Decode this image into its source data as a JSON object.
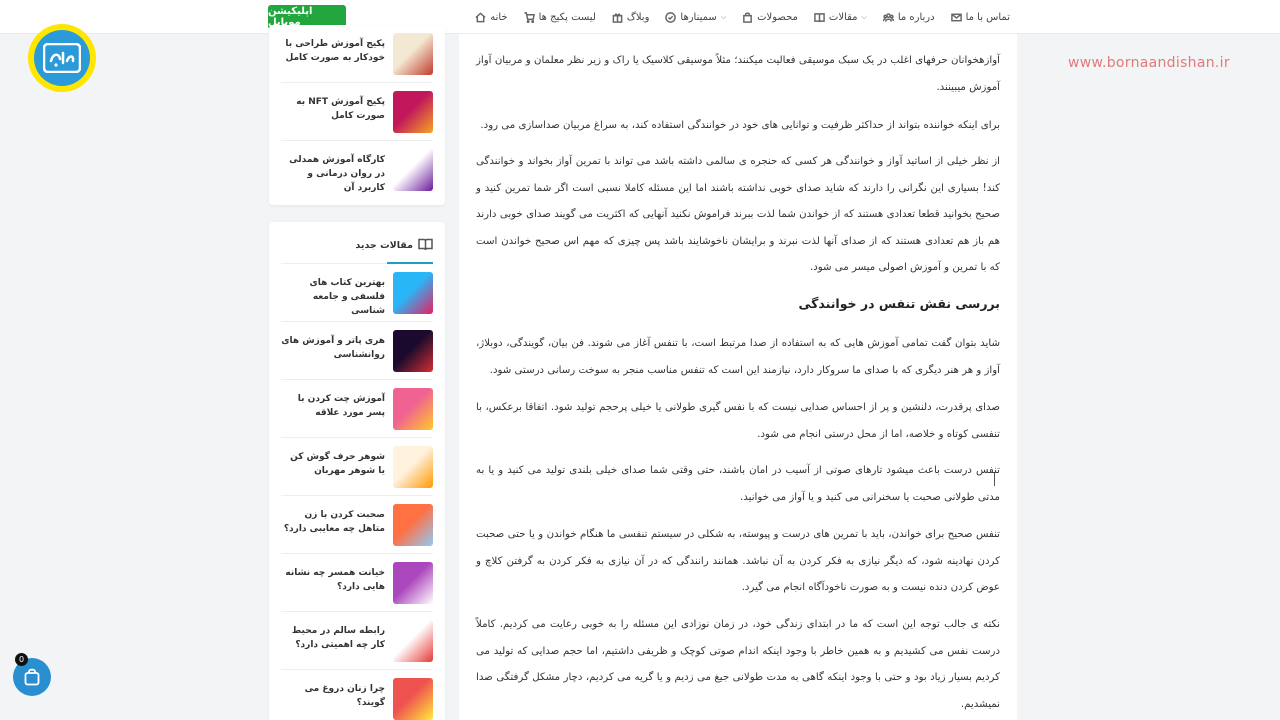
{
  "nav": {
    "items": [
      {
        "label": "خانه",
        "icon": "home-icon",
        "chevron": false
      },
      {
        "label": "لیست پکیج ها",
        "icon": "cart-icon",
        "chevron": false
      },
      {
        "label": "وبلاگ",
        "icon": "gift-icon",
        "chevron": false
      },
      {
        "label": "سمینارها",
        "icon": "check-circle-icon",
        "chevron": true
      },
      {
        "label": "محصولات",
        "icon": "bag-icon",
        "chevron": false
      },
      {
        "label": "مقالات",
        "icon": "book-icon",
        "chevron": true
      },
      {
        "label": "درباره ما",
        "icon": "users-icon",
        "chevron": false
      },
      {
        "label": "تماس با ما",
        "icon": "mail-icon",
        "chevron": false
      }
    ],
    "app_button": "اپلیکیشن موبایل"
  },
  "watermark": "www.bornaandishan.ir",
  "sidebar": {
    "packages": [
      {
        "title": "پکیج آموزش طراحی با خودکار به صورت کامل",
        "thumb_colors": [
          "#f3e9d2",
          "#c0392b"
        ]
      },
      {
        "title": "پکیج آموزش NFT به صورت کامل",
        "thumb_colors": [
          "#c2185b",
          "#f5a623"
        ]
      },
      {
        "title": "کارگاه آموزش همدلی در روان درمانی و کاربرد آن",
        "thumb_colors": [
          "#ffffff",
          "#6a1b9a"
        ]
      }
    ],
    "new_articles_title": "مقالات جدید",
    "articles": [
      {
        "title": "بهترین کتاب های فلسفی و جامعه شناسی",
        "thumb_colors": [
          "#29b6f6",
          "#e91e63"
        ]
      },
      {
        "title": "هری پاتر و آموزش های روانشناسی",
        "thumb_colors": [
          "#1a0a2e",
          "#d32f2f"
        ]
      },
      {
        "title": "آموزش چت کردن با پسر مورد علاقه",
        "thumb_colors": [
          "#f06292",
          "#ffca28"
        ]
      },
      {
        "title": "شوهر حرف گوش کن یا شوهر مهربان",
        "thumb_colors": [
          "#fff3e0",
          "#ff9800"
        ]
      },
      {
        "title": "صحبت کردن با زن متاهل چه معایبی دارد؟",
        "thumb_colors": [
          "#ff7043",
          "#90caf9"
        ]
      },
      {
        "title": "خیانت همسر چه نشانه هایی دارد؟",
        "thumb_colors": [
          "#ab47bc",
          "#ffffff"
        ]
      },
      {
        "title": "رابطه سالم در محیط کار چه اهمیتی دارد؟",
        "thumb_colors": [
          "#ffffff",
          "#e53935"
        ]
      },
      {
        "title": "چرا زنان دروغ می گویند؟",
        "thumb_colors": [
          "#ef5350",
          "#ffeb3b"
        ]
      }
    ]
  },
  "article": {
    "p1": "آوازهخوانان حرفهای اغلب در یک سبک موسیقی فعالیت میکنند؛ مثلاً موسیقی کلاسیک یا راک و زیر نظر معلمان و مربیان آواز آموزش میبینند.",
    "p2": "برای اینکه خواننده بتواند از حداکثر ظرفیت و توانایی های خود در خوانندگی استفاده کند، به سراغ مربیان صداسازی می رود.",
    "p3": "از نظر خیلی از اساتید آواز و خوانندگی هر کسی که حنجره ی سالمی داشته باشد می تواند با تمرین آواز بخواند و خوانندگی کند! بسیاری این نگرانی را دارند که شاید صدای خوبی نداشته باشند اما این مسئله کاملا نسبی است اگر شما تمرین کنید و صحیح بخوانید قطعا تعدادی هستند که از خواندن شما لذت ببرند فراموش نکنید آنهایی که اکثریت می گویند صدای خوبی دارند هم باز هم تعدادی هستند که از صدای آنها لذت نبرند و برایشان ناخوشایند باشد پس چیزی که مهم اس صحیح خواندن است که با تمرین و آموزش اصولی میسر می شود.",
    "heading": "بررسی نقش تنفس در خوانندگی",
    "p4": "شاید بتوان گفت تمامی آموزش هایی که به استفاده از صدا مرتبط است، با تنفس آغاز می شوند. فن بیان، گویندگی، دوبلاژ، آواز و هر هنر دیگری که با صدای ما سروکار دارد، نیازمند این است که تنفس مناسب منجر به سوخت رسانی درستی شود.",
    "p5": "صدای پرقدرت، دلنشین و پر از احساس صدایی نیست که با نفس گیری طولانی یا خیلی پرحجم تولید شود. اتفاقا برعکس، با تنفسی کوتاه و خلاصه، اما از محل درستی انجام می شود.",
    "p6": "تنفس درست باعث میشود تارهای صوتی از آسیب در امان باشند، حتی وقتی شما صدای خیلی بلندی تولید می کنید و یا به مدتی طولانی صحبت یا سخنرانی می کنید و یا آواز می خوانید.",
    "p7": "تنفس صحیح برای خواندن، باید با تمرین های درست و پیوسته، به شکلی در سیستم تنفسی ما هنگام خواندن و یا حتی صحبت کردن نهادینه شود، که دیگر نیازی به فکر کردن به آن نباشد. همانند رانندگی که در آن نیازی به فکر کردن به گرفتن کلاچ و عوض کردن دنده نیست و به صورت ناخودآگاه انجام می گیرد.",
    "p8": "نکته ی جالب توجه این است که ما در ابتدای زندگی خود، در زمان نوزادی این مسئله را به خوبی رعایت می کردیم. کاملاً درست نفس می کشیدیم و به همین خاطر با وجود اینکه اندام صوتی کوچک و ظریفی داشتیم، اما حجم صدایی که تولید می کردیم بسیار زیاد بود و حتی با وجود اینکه گاهی به مدت طولانی جیغ می زدیم و یا گریه می کردیم، دچار مشکل گرفتگی صدا نمیشدیم."
  },
  "cart": {
    "count": "0"
  },
  "colors": {
    "accent": "#22a73f",
    "link": "#1ba0c8",
    "cart": "#2a8fd0",
    "watermark": "#e07a7a"
  }
}
